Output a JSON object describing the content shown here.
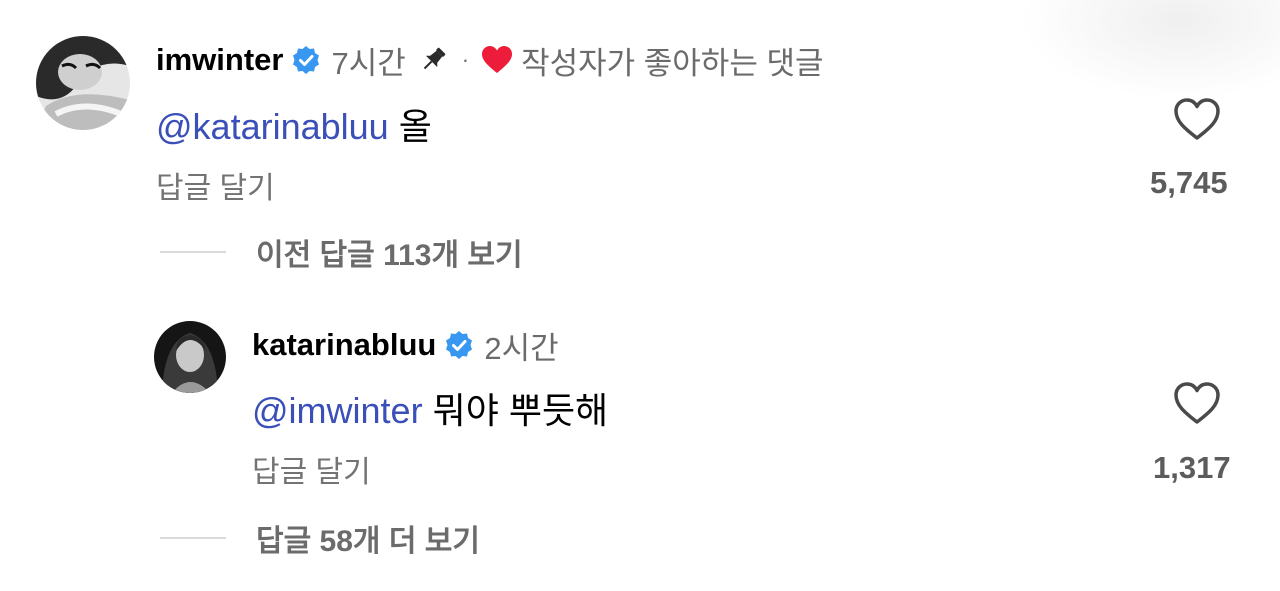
{
  "comments": [
    {
      "username": "imwinter",
      "time": "7시간",
      "pinned_icon": "pin-icon",
      "separator": "·",
      "liked_icon": "heart-filled-icon",
      "liked_by_author": "작성자가 좋아하는 댓글",
      "mention": "@katarinabluu",
      "text": "올",
      "reply_label": "답글 달기",
      "like_count": "5,745",
      "view_replies": "이전 답글 113개 보기"
    },
    {
      "username": "katarinabluu",
      "time": "2시간",
      "mention": "@imwinter",
      "text": "뭐야 뿌듯해",
      "reply_label": "답글 달기",
      "like_count": "1,317",
      "view_replies": "답글 58개 더 보기"
    }
  ],
  "colors": {
    "mention": "#3b4fb8",
    "verified": "#3897f0",
    "heart_red": "#ed1c3a",
    "muted_text": "#6b6b6b"
  }
}
